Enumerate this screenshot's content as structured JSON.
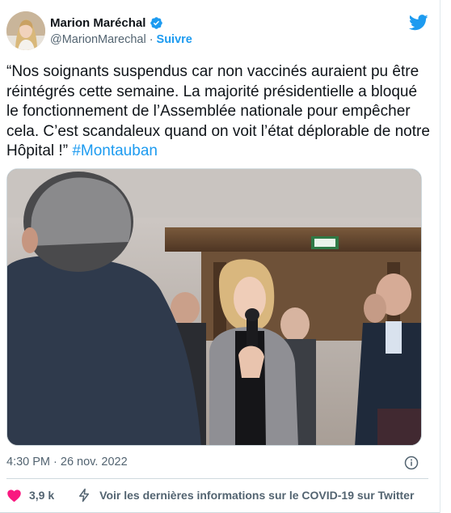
{
  "author": {
    "display_name": "Marion Maréchal",
    "handle": "@MarionMarechal",
    "separator": "·",
    "follow_label": "Suivre",
    "verified": true,
    "avatar": "profile-photo"
  },
  "brand": {
    "icon": "twitter-bird-icon",
    "color": "#1d9bf0"
  },
  "tweet": {
    "text": "“Nos soignants suspendus car non vaccinés auraient pu être réintégrés cette semaine. La majorité présidentielle a bloqué le fonctionnement de l’Assemblée nationale pour empêcher cela. C’est scandaleux quand on voit l’état déplorable de notre Hôpital !” ",
    "hashtag": "#Montauban",
    "media": "photo-woman-speaking-microphone"
  },
  "meta": {
    "timestamp": "4:30 PM · 26 nov. 2022",
    "info_icon": "info-icon"
  },
  "actions": {
    "like_count": "3,9 k",
    "like_icon": "heart-icon",
    "covid_icon": "bolt-icon",
    "covid_label": "Voir les dernières informations sur le COVID-19 sur Twitter"
  },
  "colors": {
    "text": "#0f1419",
    "secondary": "#536471",
    "link": "#1d9bf0",
    "like": "#f91880",
    "border": "#cfd9de"
  }
}
